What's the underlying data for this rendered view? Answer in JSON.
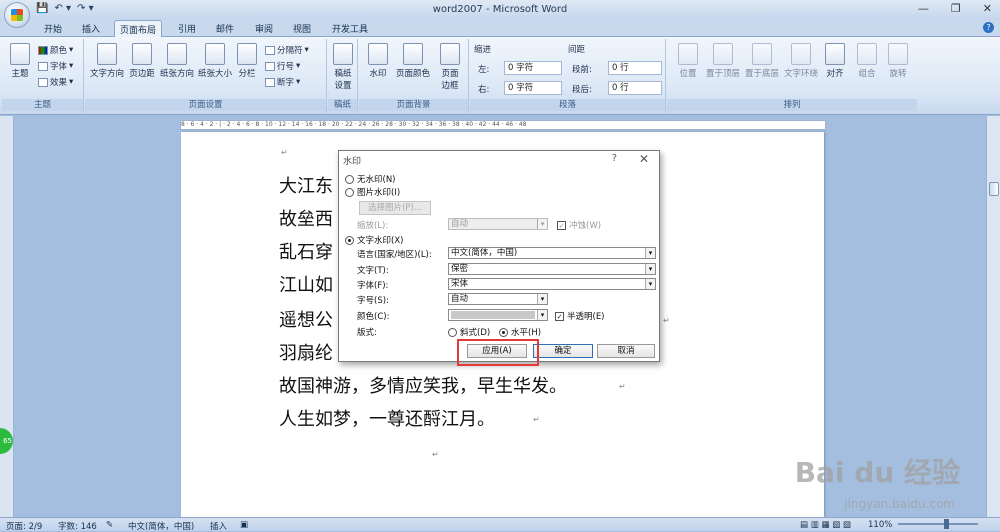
{
  "window": {
    "title": "word2007 - Microsoft Word",
    "qat_icons": [
      "save-icon",
      "undo-icon",
      "redo-icon"
    ]
  },
  "tabs": [
    "开始",
    "插入",
    "页面布局",
    "引用",
    "邮件",
    "审阅",
    "视图",
    "开发工具"
  ],
  "active_tab": "页面布局",
  "ribbon": {
    "theme": {
      "big": "主题",
      "colors": "颜色",
      "fonts": "字体",
      "effects": "效果",
      "label": "主题"
    },
    "page_setup": {
      "text_dir": "文字方向",
      "margins": "页边距",
      "orientation": "纸张方向",
      "size": "纸张大小",
      "columns": "分栏",
      "breaks": "分隔符",
      "line_numbers": "行号",
      "hyphenation": "断字",
      "label": "页面设置"
    },
    "draft": {
      "btn": "稿纸\n设置",
      "label": "稿纸"
    },
    "page_bg": {
      "watermark": "水印",
      "page_color": "页面颜色",
      "borders": "页面\n边框",
      "label": "页面背景"
    },
    "paragraph": {
      "indent": "缩进",
      "left": "左:",
      "left_val": "0 字符",
      "right": "右:",
      "right_val": "0 字符",
      "spacing": "间距",
      "before": "段前:",
      "before_val": "0 行",
      "after": "段后:",
      "after_val": "0 行",
      "label": "段落"
    },
    "arrange": {
      "position": "位置",
      "front": "置于顶层",
      "back": "置于底层",
      "wrap": "文字环绕",
      "align": "对齐",
      "group": "组合",
      "rotate": "旋转",
      "label": "排列"
    }
  },
  "ruler_text": "8 · 6 · 4 · 2 · | · 2 · 4 · 6 · 8 · 10 · 12 · 14 · 16 · 18 · 20 · 22 · 24 · 26 · 28 · 30 · 32 · 34 · 36 · 38 · 40 · 42 · 44 · 46 · 48",
  "document": {
    "lines": [
      "大江东",
      "故垒西",
      "乱石穿",
      "江山如",
      "遥想公",
      "羽扇纶",
      "故国神游，多情应笑我，早生华发。",
      "人生如梦，一尊还酹江月。"
    ]
  },
  "dialog": {
    "title": "水印",
    "help": "?",
    "close": "✕",
    "no_watermark": "无水印(N)",
    "picture_watermark": "图片水印(I)",
    "select_picture": "选择图片(P)...",
    "scale_label": "缩放(L):",
    "scale_value": "自动",
    "washout": "冲蚀(W)",
    "text_watermark": "文字水印(X)",
    "language_label": "语言(国家/地区)(L):",
    "language_value": "中文(简体，中国)",
    "text_label": "文字(T):",
    "text_value": "保密",
    "font_label": "字体(F):",
    "font_value": "宋体",
    "size_label": "字号(S):",
    "size_value": "自动",
    "color_label": "颜色(C):",
    "semi_transparent": "半透明(E)",
    "layout_label": "版式:",
    "diagonal": "斜式(D)",
    "horizontal": "水平(H)",
    "apply": "应用(A)",
    "ok": "确定",
    "cancel": "取消"
  },
  "status": {
    "page": "页面: 2/9",
    "words": "字数: 146",
    "lang": "中文(简体，中国)",
    "mode": "插入",
    "zoom": "110%"
  },
  "watermark_site": {
    "logo": "Bai du 经验",
    "url": "jingyan.baidu.com"
  }
}
